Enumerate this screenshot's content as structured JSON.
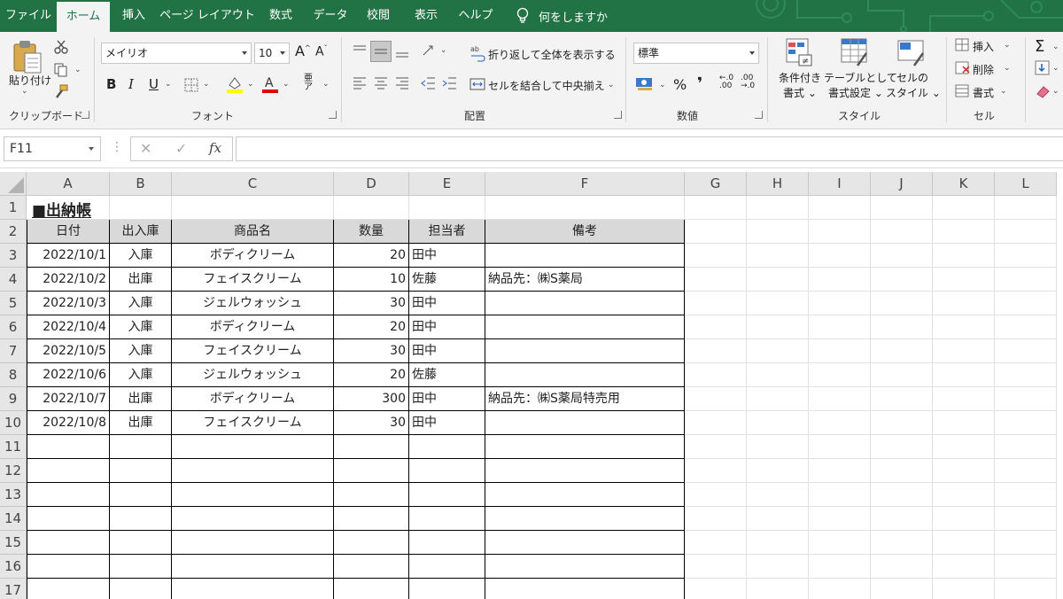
{
  "tabs": [
    "ファイル",
    "ホーム",
    "挿入",
    "ページ レイアウト",
    "数式",
    "データ",
    "校閲",
    "表示",
    "ヘルプ"
  ],
  "active_tab": "ホーム",
  "tell_me": "何をしますか",
  "ribbon": {
    "clipboard": {
      "paste": "貼り付け",
      "label": "クリップボード"
    },
    "font": {
      "name": "メイリオ",
      "size": "10",
      "bold": "B",
      "italic": "I",
      "underline": "U",
      "label": "フォント"
    },
    "alignment": {
      "wrap": "折り返して全体を表示する",
      "merge": "セルを結合して中央揃え",
      "label": "配置"
    },
    "number": {
      "format": "標準",
      "percent": "%",
      "comma": "❜",
      "label": "数値"
    },
    "styles": {
      "conditional_line1": "条件付き",
      "conditional_line2": "書式",
      "table_line1": "テーブルとして",
      "table_line2": "書式設定",
      "cell_line1": "セルの",
      "cell_line2": "スタイル",
      "label": "スタイル"
    },
    "cells": {
      "insert": "挿入",
      "delete": "削除",
      "format": "書式",
      "label": "セル"
    }
  },
  "formula_bar": {
    "name_box": "F11",
    "fx": "fx",
    "content": ""
  },
  "columns": [
    "A",
    "B",
    "C",
    "D",
    "E",
    "F",
    "G",
    "H",
    "I",
    "J",
    "K",
    "L"
  ],
  "rows": [
    "1",
    "2",
    "3",
    "4",
    "5",
    "6",
    "7",
    "8",
    "9",
    "10",
    "11",
    "12",
    "13",
    "14",
    "15",
    "16",
    "17"
  ],
  "sheet": {
    "title": "■出納帳",
    "headers": [
      "日付",
      "出入庫",
      "商品名",
      "数量",
      "担当者",
      "備考"
    ],
    "records": [
      [
        "2022/10/1",
        "入庫",
        "ボディクリーム",
        "20",
        "田中",
        ""
      ],
      [
        "2022/10/2",
        "出庫",
        "フェイスクリーム",
        "10",
        "佐藤",
        "納品先：㈱S薬局"
      ],
      [
        "2022/10/3",
        "入庫",
        "ジェルウォッシュ",
        "30",
        "田中",
        ""
      ],
      [
        "2022/10/4",
        "入庫",
        "ボディクリーム",
        "20",
        "田中",
        ""
      ],
      [
        "2022/10/5",
        "入庫",
        "フェイスクリーム",
        "30",
        "田中",
        ""
      ],
      [
        "2022/10/6",
        "入庫",
        "ジェルウォッシュ",
        "20",
        "佐藤",
        ""
      ],
      [
        "2022/10/7",
        "出庫",
        "ボディクリーム",
        "300",
        "田中",
        "納品先：㈱S薬局特売用"
      ],
      [
        "2022/10/8",
        "出庫",
        "フェイスクリーム",
        "30",
        "田中",
        ""
      ]
    ]
  },
  "colors": {
    "excel_green": "#217346",
    "ribbon_bg": "#f3f3f3",
    "header_fill": "#d9d9d9"
  }
}
